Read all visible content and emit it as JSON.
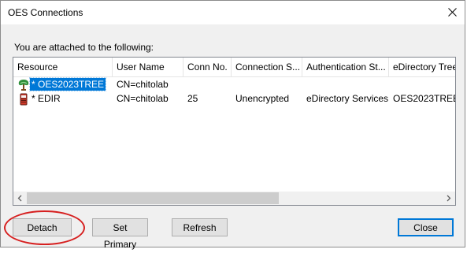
{
  "window": {
    "title": "OES Connections"
  },
  "intro_text": "You are attached to the following:",
  "columns": [
    "Resource",
    "User Name",
    "Conn No.",
    "Connection S...",
    "Authentication St...",
    "eDirectory Tree"
  ],
  "rows": [
    {
      "resource": "* OES2023TREE",
      "icon": "tree-icon",
      "user": "CN=chitolab",
      "conn": "",
      "conn_state": "",
      "auth": "",
      "tree": ""
    },
    {
      "resource": "* EDIR",
      "icon": "server-icon",
      "user": "CN=chitolab",
      "conn": "25",
      "conn_state": "Unencrypted",
      "auth": "eDirectory Services",
      "tree": "OES2023TREE"
    }
  ],
  "buttons": {
    "detach": "Detach",
    "set_primary": "Set Primary",
    "refresh": "Refresh",
    "close": "Close"
  },
  "colors": {
    "selection": "#0078d7",
    "annotation_ring": "#d62020"
  }
}
